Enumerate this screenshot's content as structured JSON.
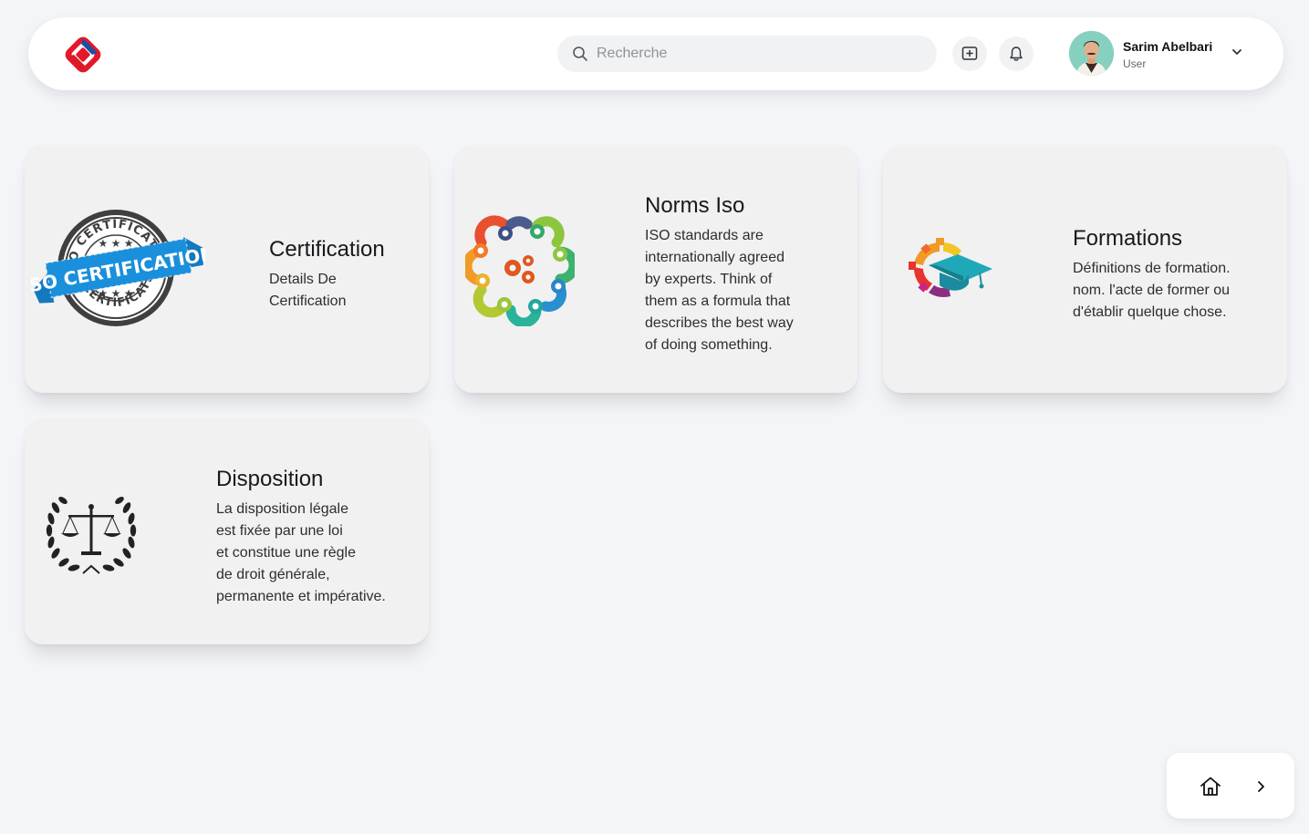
{
  "header": {
    "logo_icon": "app-logo",
    "search": {
      "placeholder": "Recherche",
      "value": ""
    },
    "actions": [
      {
        "name": "add-icon"
      },
      {
        "name": "bell-icon"
      }
    ],
    "user": {
      "name": "Sarim Abelbari",
      "role": "User"
    }
  },
  "cards": [
    {
      "title": "Certification",
      "description": [
        "Details De",
        "Certification"
      ],
      "badge_text_top": "ISO CERTIFICATION",
      "ribbon_text": "ISO CERTIFICATION",
      "badge_text_bottom": "ISO CERTIFICATION"
    },
    {
      "title": "Norms Iso",
      "description": [
        "ISO standards are",
        "internationally agreed",
        "by experts. Think of",
        "them as a formula that",
        "describes the best way",
        "of doing something."
      ]
    },
    {
      "title": "Formations",
      "description": [
        "Définitions de formation.",
        "nom. l'acte de former ou",
        "d'établir quelque chose."
      ]
    },
    {
      "title": "Disposition",
      "description": [
        "La disposition légale",
        "est fixée par une loi",
        "et constitue une règle",
        "de droit générale,",
        "permanente et impérative."
      ]
    }
  ],
  "bottom_nav": {
    "home_icon": "home-icon",
    "next_icon": "chevron-right-icon"
  },
  "colors": {
    "background": "#f4f5f8",
    "card": "#f1f1f1",
    "ribbon_blue": "#1a8fdc",
    "logo_red": "#e3192a",
    "logo_blue": "#1d4fa3"
  }
}
